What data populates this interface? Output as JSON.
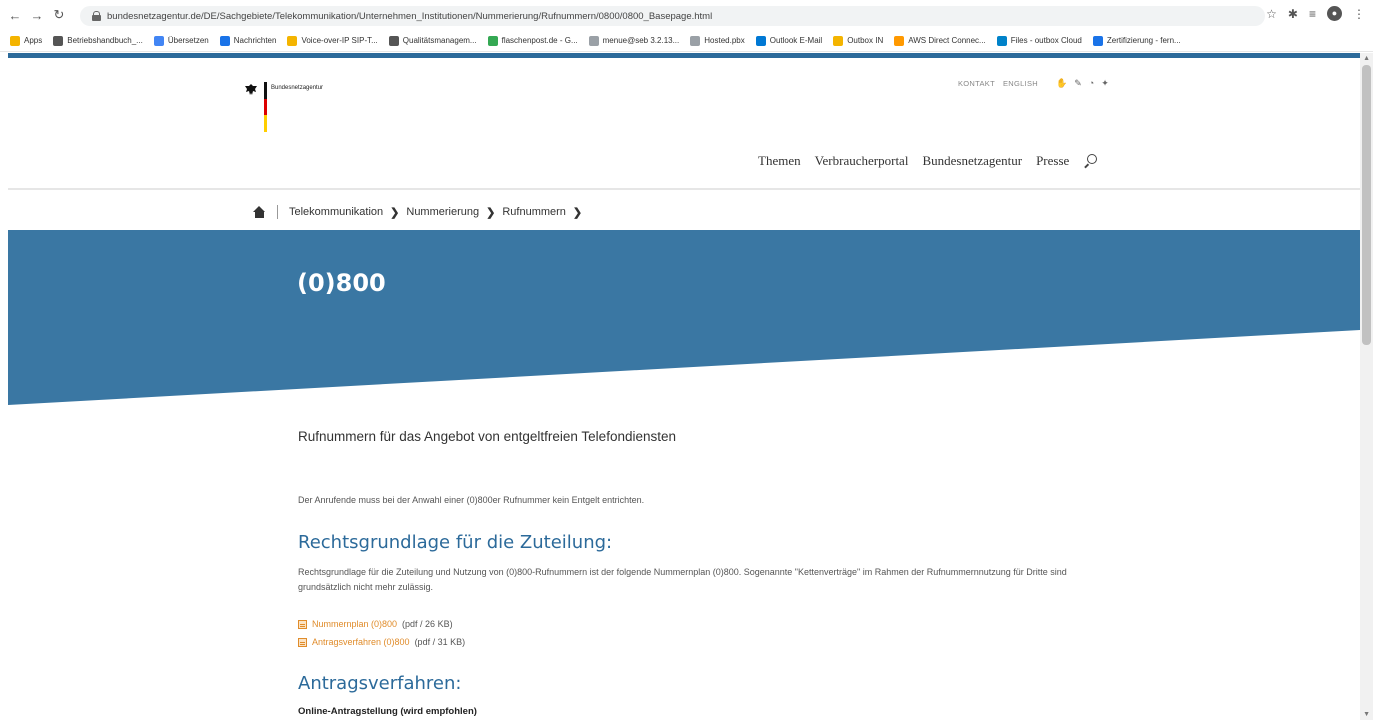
{
  "browser": {
    "url": "bundesnetzagentur.de/DE/Sachgebiete/Telekommunikation/Unternehmen_Institutionen/Nummerierung/Rufnummern/0800/0800_Basepage.html",
    "bookmarks": [
      {
        "label": "Apps",
        "color": "#f4b400"
      },
      {
        "label": "Betriebshandbuch_...",
        "color": "#555555"
      },
      {
        "label": "Übersetzen",
        "color": "#4285f4"
      },
      {
        "label": "Nachrichten",
        "color": "#1a73e8"
      },
      {
        "label": "Voice-over-IP SIP-T...",
        "color": "#f4b400"
      },
      {
        "label": "Qualitätsmanagem...",
        "color": "#555555"
      },
      {
        "label": "flaschenpost.de - G...",
        "color": "#34a853"
      },
      {
        "label": "menue@seb 3.2.13...",
        "color": "#9aa0a6"
      },
      {
        "label": "Hosted.pbx",
        "color": "#9aa0a6"
      },
      {
        "label": "Outlook E-Mail",
        "color": "#0078d4"
      },
      {
        "label": "Outbox IN",
        "color": "#f4b400"
      },
      {
        "label": "AWS Direct Connec...",
        "color": "#ff9900"
      },
      {
        "label": "Files - outbox Cloud",
        "color": "#0082c9"
      },
      {
        "label": "Zertifizierung - fern...",
        "color": "#1a73e8"
      }
    ]
  },
  "site": {
    "logo_text": "Bundesnetzagentur",
    "service_links": [
      "KONTAKT",
      "ENGLISH"
    ],
    "main_nav": [
      "Themen",
      "Verbraucherportal",
      "Bundesnetzagentur",
      "Presse"
    ],
    "breadcrumb": [
      "Telekommunikation",
      "Nummerierung",
      "Rufnummern"
    ]
  },
  "hero": {
    "title": "(0)800",
    "color": "#3a77a3"
  },
  "content": {
    "lead": "Rufnummern für das Angebot von entgeltfreien Telefondiensten",
    "intro": "Der Anrufende muss bei der Anwahl einer (0)800er Rufnummer kein Entgelt entrichten.",
    "section1_title": "Rechtsgrundlage für die Zuteilung:",
    "section1_text": "Rechtsgrundlage für die Zuteilung und Nutzung von (0)800-Rufnummern ist der folgende Nummernplan (0)800. Sogenannte \"Kettenverträge\" im Rahmen der Rufnummernnutzung für Dritte sind grundsätzlich nicht mehr zulässig.",
    "downloads": [
      {
        "link": "Nummernplan (0)800",
        "meta": "(pdf / 26 KB)"
      },
      {
        "link": "Antragsverfahren (0)800",
        "meta": "(pdf / 31 KB)"
      }
    ],
    "section2_title": "Antragsverfahren:",
    "section2_subhead": "Online-Antragstellung (wird empfohlen)"
  }
}
